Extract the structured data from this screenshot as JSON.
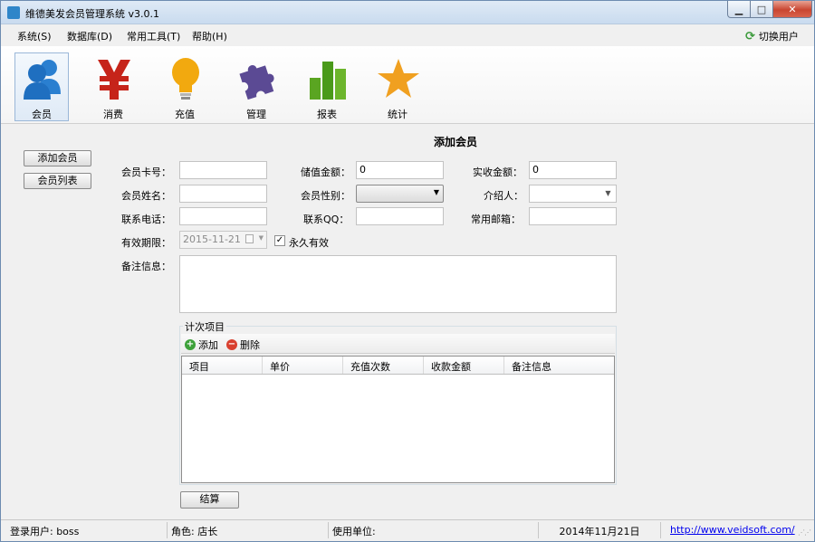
{
  "window": {
    "title": "维德美发会员管理系统 v3.0.1",
    "min_label": "▁",
    "max_label": "□",
    "close_label": "✕"
  },
  "menu": {
    "items": [
      {
        "label": "系统(S)"
      },
      {
        "label": "数据库(D)"
      },
      {
        "label": "常用工具(T)"
      },
      {
        "label": "帮助(H)"
      }
    ],
    "switch_user": "切换用户",
    "switch_icon": "refresh-icon"
  },
  "toolbar": {
    "items": [
      {
        "label": "会员",
        "icon": "members-icon",
        "active": true
      },
      {
        "label": "消费",
        "icon": "yen-icon"
      },
      {
        "label": "充值",
        "icon": "bulb-icon"
      },
      {
        "label": "管理",
        "icon": "puzzle-icon"
      },
      {
        "label": "报表",
        "icon": "bar-chart-icon"
      },
      {
        "label": "统计",
        "icon": "star-icon"
      }
    ]
  },
  "sidebar": {
    "add_member": "添加会员",
    "member_list": "会员列表"
  },
  "form": {
    "title": "添加会员",
    "card_no_label": "会员卡号：",
    "card_no_value": "",
    "stored_amount_label": "储值金额：",
    "stored_amount_value": "0",
    "received_amount_label": "实收金额：",
    "received_amount_value": "0",
    "name_label": "会员姓名：",
    "name_value": "",
    "gender_label": "会员性别：",
    "gender_value": "",
    "referrer_label": "介绍人：",
    "referrer_value": "",
    "phone_label": "联系电话：",
    "phone_value": "",
    "qq_label": "联系QQ：",
    "qq_value": "",
    "email_label": "常用邮箱：",
    "email_value": "",
    "valid_until_label": "有效期限：",
    "valid_until_value": "2015-11-21",
    "permanent_label": "永久有效",
    "permanent_checked": true,
    "check_mark": "✓",
    "notes_label": "备注信息：",
    "notes_value": ""
  },
  "items_group": {
    "title": "计次项目",
    "add_label": "添加",
    "delete_label": "删除",
    "add_glyph": "+",
    "delete_glyph": "−",
    "columns": [
      "项目",
      "单价",
      "充值次数",
      "收款金额",
      "备注信息"
    ],
    "rows": []
  },
  "settle_button": "结算",
  "status": {
    "user": "登录用户: boss",
    "role": "角色: 店长",
    "unit": "使用单位:",
    "date": "2014年11月21日",
    "url": "http://www.veidsoft.com/"
  },
  "colors": {
    "accent": "#2f86c9",
    "close_button": "#c94631",
    "members_icon": "#1f6fc0",
    "yen_icon": "#c6241a",
    "bulb_icon": "#f2a90f",
    "puzzle_icon": "#5b4a94",
    "chart_icon": "#5aa521",
    "star_icon": "#f0a020"
  }
}
